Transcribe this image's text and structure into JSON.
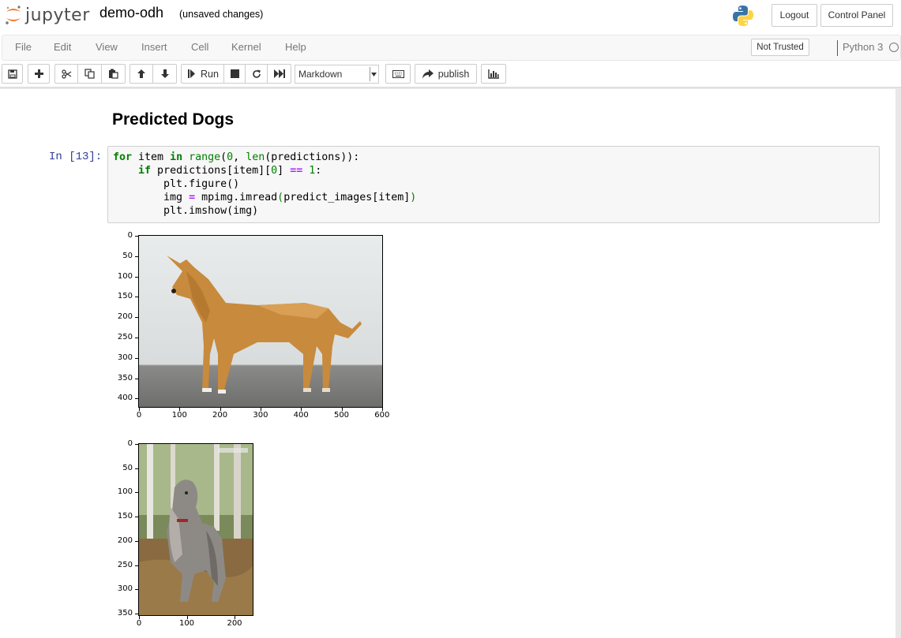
{
  "header": {
    "logo_text": "jupyter",
    "notebook_name": "demo-odh",
    "save_status": "(unsaved changes)",
    "logout_label": "Logout",
    "control_panel_label": "Control Panel"
  },
  "menubar": {
    "items": [
      "File",
      "Edit",
      "View",
      "Insert",
      "Cell",
      "Kernel",
      "Help"
    ],
    "trusted_label": "Not Trusted",
    "kernel_name": "Python 3"
  },
  "toolbar": {
    "run_label": "Run",
    "cell_type": "Markdown",
    "publish_label": "publish",
    "icons": [
      "save-icon",
      "plus-icon",
      "cut-icon",
      "copy-icon",
      "paste-icon",
      "arrow-up-icon",
      "arrow-down-icon",
      "run-icon",
      "stop-icon",
      "restart-icon",
      "fast-forward-icon",
      "keyboard-icon",
      "share-icon",
      "bar-chart-icon"
    ]
  },
  "notebook": {
    "markdown_heading": "Predicted Dogs",
    "cell_prompt": "In [13]:",
    "code_lines": [
      "for item in range(0, len(predictions)):",
      "    if predictions[item][0] == 1:",
      "        plt.figure()",
      "        img = mpimg.imread(predict_images[item])",
      "        plt.imshow(img)"
    ],
    "outputs": [
      {
        "description": "image of a tan scruffy dog standing on a grey surface",
        "y_ticks": [
          "0",
          "50",
          "100",
          "150",
          "200",
          "250",
          "300",
          "350",
          "400"
        ],
        "x_ticks": [
          "0",
          "100",
          "200",
          "300",
          "400",
          "500",
          "600"
        ]
      },
      {
        "description": "image of a long-haired afghan hound standing in a forest",
        "y_ticks": [
          "0",
          "50",
          "100",
          "150",
          "200",
          "250",
          "300",
          "350"
        ],
        "x_ticks": [
          "0",
          "100",
          "200"
        ]
      }
    ]
  },
  "colors": {
    "prompt_blue": "#303f9f",
    "keyword_green": "#008000",
    "operator_purple": "#aa22ff",
    "logo_orange": "#f37726"
  }
}
